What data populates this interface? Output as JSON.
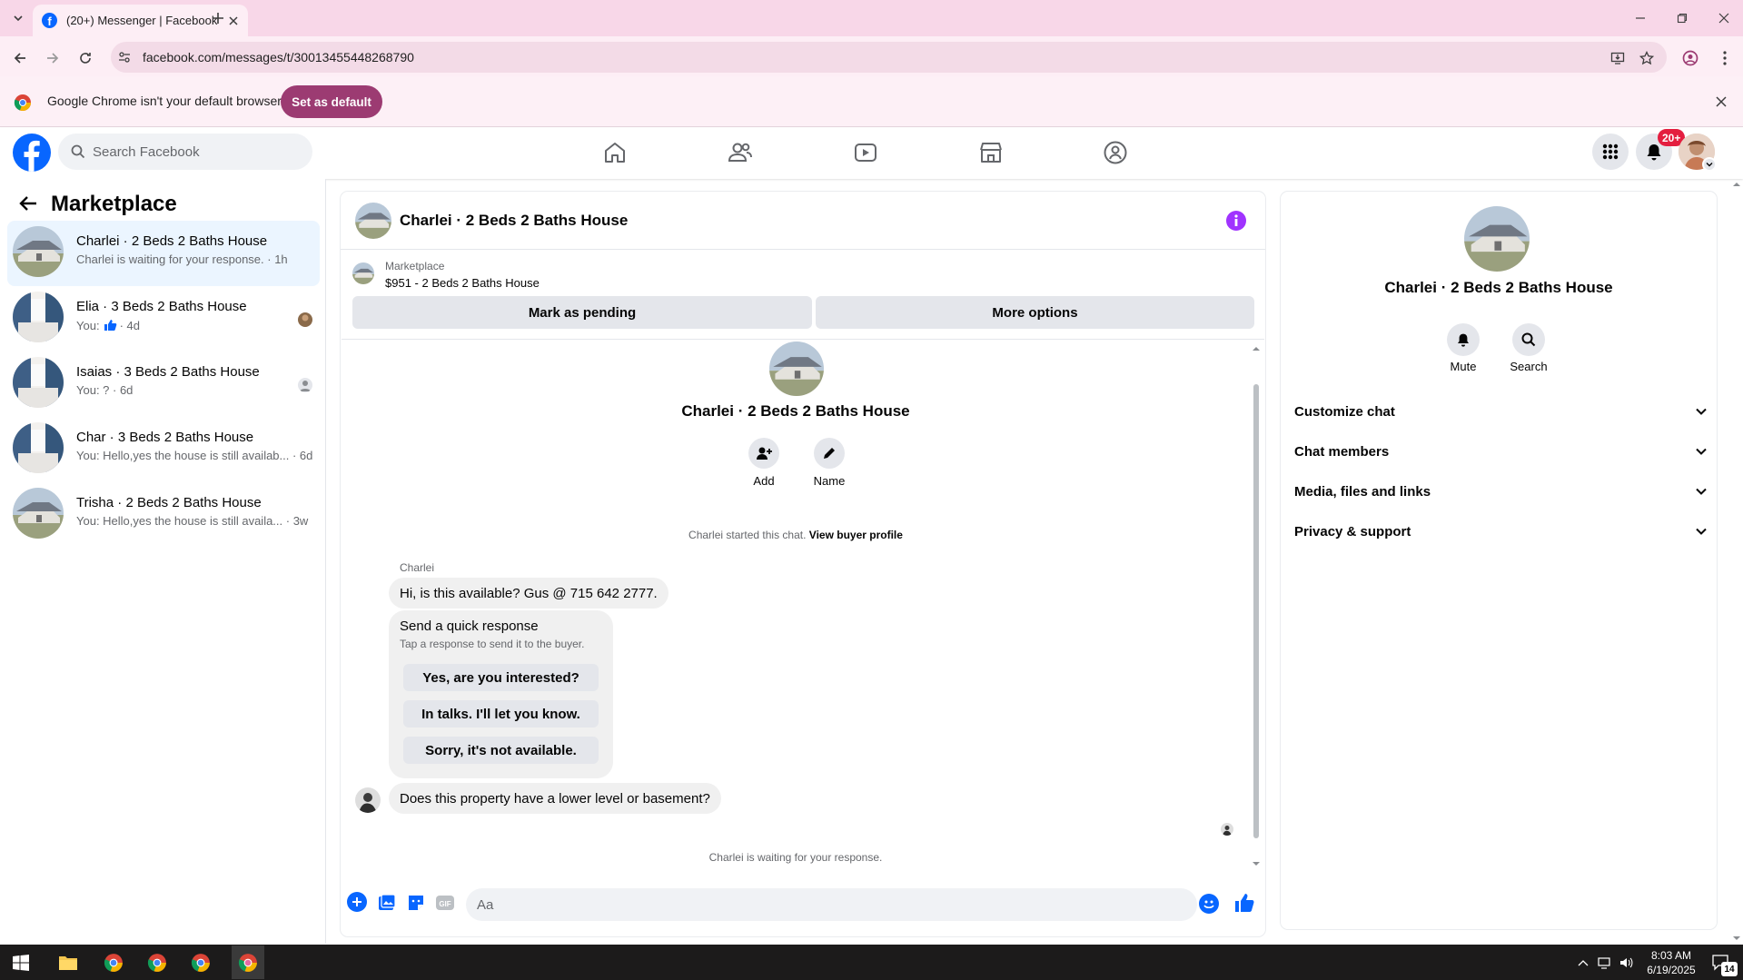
{
  "browser": {
    "tab_title": "(20+) Messenger | Facebook",
    "url": "facebook.com/messages/t/30013455448268790",
    "infobar_message": "Google Chrome isn't your default browser",
    "set_default_label": "Set as default"
  },
  "fb": {
    "search_placeholder": "Search Facebook",
    "notification_badge": "20+",
    "nav_icons": [
      "home-icon",
      "friends-icon",
      "video-icon",
      "marketplace-icon",
      "groups-icon"
    ]
  },
  "sidebar": {
    "title": "Marketplace",
    "conversations": [
      {
        "name": "Charlei · 2 Beds 2 Baths House",
        "preview": "Charlei is waiting for your response. · 1h",
        "active": true
      },
      {
        "name": "Elia · 3 Beds 2 Baths House",
        "preview_prefix": "You:",
        "preview_suffix": "· 4d"
      },
      {
        "name": "Isaias · 3 Beds 2 Baths House",
        "preview": "You: ? · 6d"
      },
      {
        "name": "Char · 3 Beds 2 Baths House",
        "preview": "You: Hello,yes the house is still availab... · 6d"
      },
      {
        "name": "Trisha · 2 Beds 2 Baths House",
        "preview": "You: Hello,yes the house is still availa... · 3w"
      }
    ]
  },
  "chat": {
    "header_title": "Charlei · 2 Beds 2 Baths House",
    "listing_source": "Marketplace",
    "listing_price_title": "$951 - 2 Beds 2 Baths House",
    "mark_pending_label": "Mark as pending",
    "more_options_label": "More options",
    "profile_name": "Charlei · 2 Beds 2 Baths House",
    "add_label": "Add",
    "name_label": "Name",
    "started_text": "Charlei started this chat.",
    "view_buyer_label": "View buyer profile",
    "sender_name": "Charlei",
    "message_1": "Hi, is this available? Gus @ 715 642 2777.",
    "quick_title": "Send a quick response",
    "quick_subtitle": "Tap a response to send it to the buyer.",
    "quick_replies": [
      "Yes, are you interested?",
      "In talks. I'll let you know.",
      "Sorry, it's not available."
    ],
    "message_2": "Does this property have a lower level or basement?",
    "waiting_text": "Charlei is waiting for your response.",
    "composer_placeholder": "Aa"
  },
  "details": {
    "name": "Charlei · 2 Beds 2 Baths House",
    "mute_label": "Mute",
    "search_label": "Search",
    "sections": [
      "Customize chat",
      "Chat members",
      "Media, files and links",
      "Privacy & support"
    ]
  },
  "taskbar": {
    "time": "8:03 AM",
    "date": "6/19/2025",
    "notification_count": "14"
  },
  "colors": {
    "fb_blue": "#0866ff",
    "messenger_accent": "#a033ff",
    "chrome_frame": "#f8d7e8",
    "set_default_bg": "#9c3b72",
    "badge_red": "#e41e3f"
  }
}
